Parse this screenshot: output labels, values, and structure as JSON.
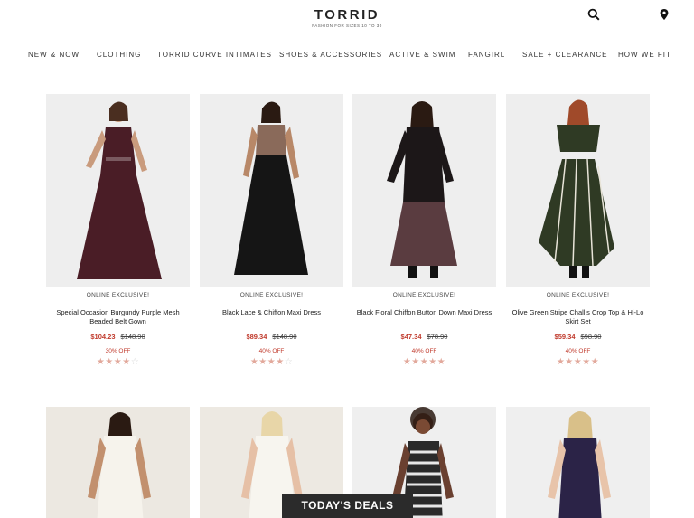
{
  "header": {
    "logo": "TORRID",
    "tagline": "FASHION FOR SIZES 10 TO 30",
    "icons": [
      "search-icon",
      "location-pin-icon"
    ]
  },
  "nav": {
    "items": [
      "NEW & NOW",
      "CLOTHING",
      "TORRID CURVE INTIMATES",
      "SHOES & ACCESSORIES",
      "ACTIVE & SWIM",
      "FANGIRL",
      "SALE + CLEARANCE",
      "HOW WE FIT"
    ]
  },
  "products": [
    {
      "badge": "ONLINE EXCLUSIVE!",
      "name": "Special Occasion Burgundy Purple Mesh Beaded Belt Gown",
      "sale_price": "$104.23",
      "original_price": "$148.90",
      "discount": "30% OFF",
      "rating": 4,
      "stars_on": "★★★★",
      "stars_off": "☆",
      "dress_color": "#4a1d26",
      "background": "#eeeeee"
    },
    {
      "badge": "ONLINE EXCLUSIVE!",
      "name": "Black Lace & Chiffon Maxi Dress",
      "sale_price": "$89.34",
      "original_price": "$148.90",
      "discount": "40% OFF",
      "rating": 4,
      "stars_on": "★★★★",
      "stars_off": "☆",
      "dress_color": "#151515",
      "background": "#eeeeee"
    },
    {
      "badge": "ONLINE EXCLUSIVE!",
      "name": "Black Floral Chiffon Button Down Maxi Dress",
      "sale_price": "$47.34",
      "original_price": "$78.90",
      "discount": "40% OFF",
      "rating": 4.5,
      "stars_on": "★★★★★",
      "stars_off": "",
      "dress_color": "#1c1718",
      "background": "#eeeeee"
    },
    {
      "badge": "ONLINE EXCLUSIVE!",
      "name": "Olive Green Stripe Challis Crop Top & Hi-Lo Skirt Set",
      "sale_price": "$59.34",
      "original_price": "$98.90",
      "discount": "40% OFF",
      "rating": 5,
      "stars_on": "★★★★★",
      "stars_off": "",
      "dress_color": "#2f3a24",
      "background": "#eeeeee"
    },
    {
      "dress_color": "#f6f3ec",
      "background": "#ece8e1"
    },
    {
      "dress_color": "#f7f5ef",
      "background": "#ede9e2"
    },
    {
      "dress_color": "#2a2a2a",
      "background": "#efefef"
    },
    {
      "dress_color": "#2b2347",
      "background": "#efefef"
    }
  ],
  "deals_button": "TODAY'S DEALS"
}
